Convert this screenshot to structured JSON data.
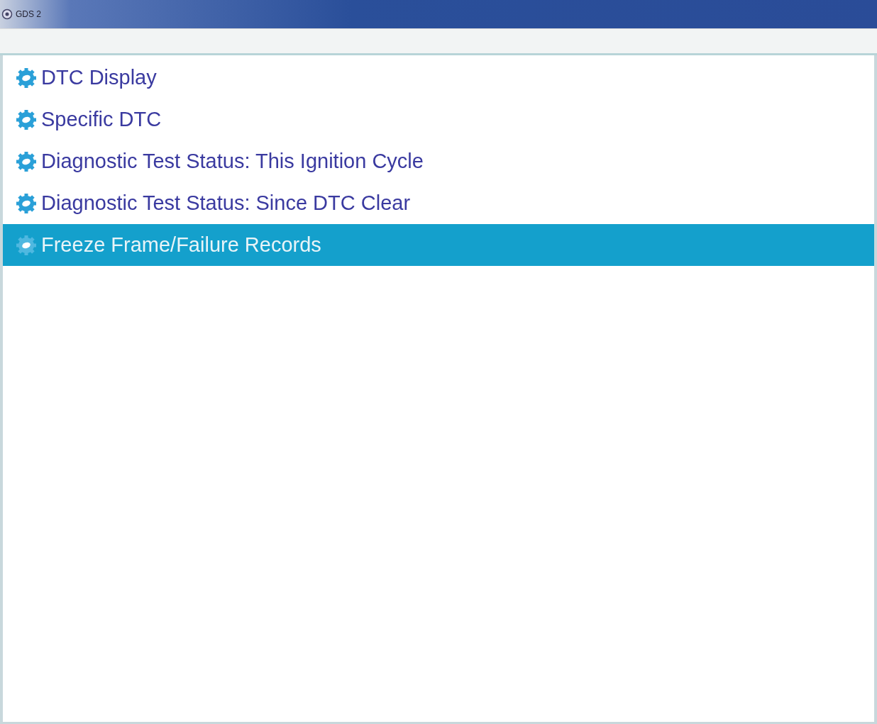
{
  "window": {
    "title": "GDS 2"
  },
  "menu": [
    {
      "label": "DTC Display",
      "selected": false
    },
    {
      "label": "Specific DTC",
      "selected": false
    },
    {
      "label": "Diagnostic Test Status: This Ignition Cycle",
      "selected": false
    },
    {
      "label": "Diagnostic Test Status: Since DTC Clear",
      "selected": false
    },
    {
      "label": "Freeze Frame/Failure Records",
      "selected": true
    }
  ]
}
